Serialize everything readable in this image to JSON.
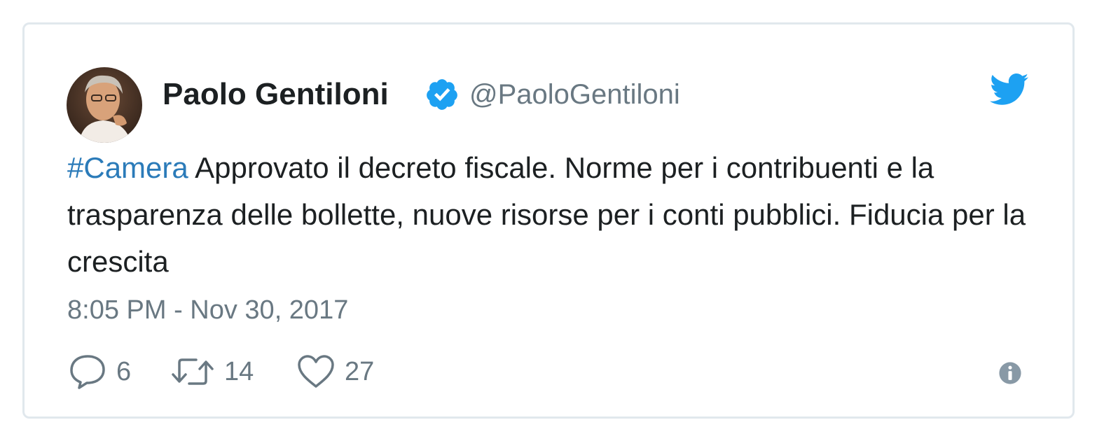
{
  "author": {
    "name": "Paolo Gentiloni",
    "handle": "@PaoloGentiloni",
    "avatar_icon": "profile-photo",
    "verified_icon": "verified-badge-icon"
  },
  "brand_icon": "twitter-bird-icon",
  "tweet": {
    "hashtag": "#Camera",
    "text": " Approvato il decreto fiscale. Norme per i contribuenti e la trasparenza delle bollette, nuove risorse per i conti pubblici. Fiducia per la crescita",
    "timestamp": "8:05 PM - Nov 30, 2017"
  },
  "actions": {
    "reply_count": "6",
    "retweet_count": "14",
    "like_count": "27"
  },
  "info_icon": "info-icon",
  "colors": {
    "text": "#1c2022",
    "muted": "#697882",
    "link": "#2b7bb9",
    "brand": "#1da1f2",
    "border": "#e1e8ed"
  }
}
